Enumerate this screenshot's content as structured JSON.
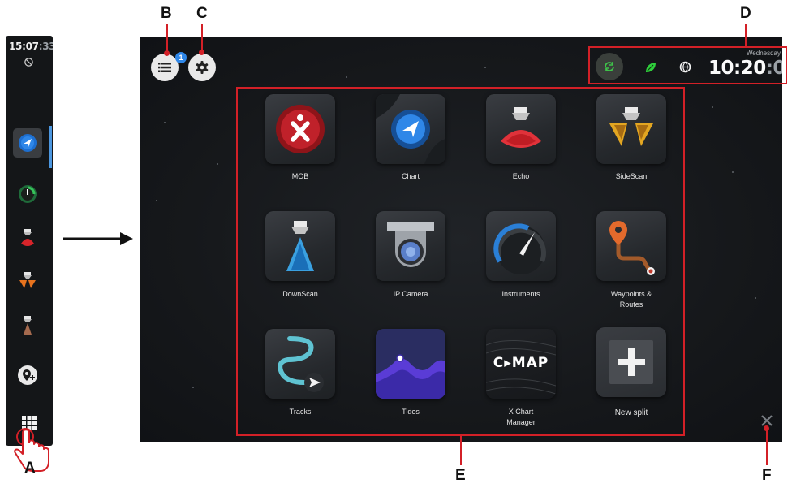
{
  "sidebar": {
    "time_hm": "15:07",
    "time_sec": ":33",
    "items": [
      {
        "name": "chart",
        "icon": "chart-navigation-icon",
        "active": true
      },
      {
        "name": "instruments",
        "icon": "gauge-icon",
        "active": false
      },
      {
        "name": "echo",
        "icon": "echo-sonar-icon",
        "active": false
      },
      {
        "name": "sidescan",
        "icon": "sidescan-sonar-icon",
        "active": false
      },
      {
        "name": "downscan",
        "icon": "downscan-sonar-icon",
        "active": false
      },
      {
        "name": "add-waypoint",
        "icon": "add-waypoint-icon",
        "active": false
      },
      {
        "name": "apps",
        "icon": "app-grid-icon",
        "active": false
      }
    ]
  },
  "callouts": {
    "a": "A",
    "b": "B",
    "c": "C",
    "d": "D",
    "e": "E",
    "f": "F"
  },
  "header": {
    "menu_badge": "1",
    "day": "Wednesday",
    "clock_hm": "10:20",
    "clock_sec": ":01"
  },
  "apps": [
    {
      "label": "MOB",
      "icon": "mob-icon"
    },
    {
      "label": "Chart",
      "icon": "chart-icon"
    },
    {
      "label": "Echo",
      "icon": "echo-icon"
    },
    {
      "label": "SideScan",
      "icon": "sidescan-icon"
    },
    {
      "label": "DownScan",
      "icon": "downscan-icon"
    },
    {
      "label": "IP Camera",
      "icon": "ip-camera-icon"
    },
    {
      "label": "Instruments",
      "icon": "instruments-icon"
    },
    {
      "label": "Waypoints &",
      "label2": "Routes",
      "icon": "waypoints-icon"
    },
    {
      "label": "Tracks",
      "icon": "tracks-icon"
    },
    {
      "label": "Tides",
      "icon": "tides-icon"
    },
    {
      "label": "X Chart",
      "label2": "Manager",
      "icon": "x-chart-manager-icon",
      "logo_text": "C▸MAP"
    },
    {
      "label": "New split",
      "icon": "new-split-icon"
    }
  ],
  "colors": {
    "callout_red": "#d32027",
    "accent_blue": "#2f87e8",
    "sync_green": "#3ec44a"
  }
}
